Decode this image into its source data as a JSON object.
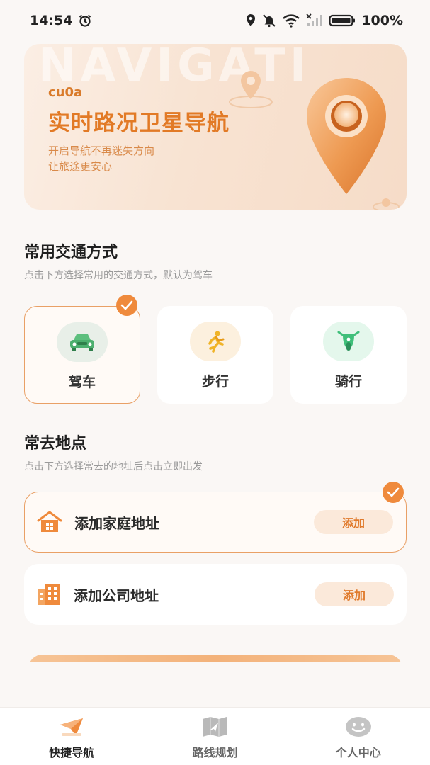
{
  "status_bar": {
    "time": "14:54",
    "battery": "100%",
    "icons": [
      "alarm-icon",
      "location-icon",
      "mute-icon",
      "wifi-icon",
      "signal-icon",
      "battery-icon"
    ]
  },
  "banner": {
    "bg_word": "NAVIGATI",
    "brand": "cu0a",
    "title": "实时路况卫星导航",
    "subtitle_line1": "开启导航不再迷失方向",
    "subtitle_line2": "让旅途更安心"
  },
  "transport": {
    "title": "常用交通方式",
    "description": "点击下方选择常用的交通方式，默认为驾车",
    "selected": "drive",
    "modes": [
      {
        "key": "drive",
        "label": "驾车",
        "icon": "car-icon",
        "color": "#4caf6e",
        "bg": "#e8efe8"
      },
      {
        "key": "walk",
        "label": "步行",
        "icon": "walk-icon",
        "color": "#f0b428",
        "bg": "#fcf0de"
      },
      {
        "key": "ride",
        "label": "骑行",
        "icon": "scooter-icon",
        "color": "#3fbf7a",
        "bg": "#e4f7ec"
      }
    ]
  },
  "places": {
    "title": "常去地点",
    "description": "点击下方选择常去的地址后点击立即出发",
    "items": [
      {
        "label": "添加家庭地址",
        "button": "添加",
        "icon": "home-icon",
        "selected": true
      },
      {
        "label": "添加公司地址",
        "button": "添加",
        "icon": "office-building-icon",
        "selected": false
      }
    ]
  },
  "tabs": [
    {
      "label": "快捷导航",
      "icon": "navigation-arrow-icon",
      "active": true
    },
    {
      "label": "路线规划",
      "icon": "map-route-icon",
      "active": false
    },
    {
      "label": "个人中心",
      "icon": "smiley-profile-icon",
      "active": false
    }
  ],
  "colors": {
    "accent": "#ef8a3c",
    "background": "#faf7f5",
    "selected_border": "#e9a066"
  }
}
